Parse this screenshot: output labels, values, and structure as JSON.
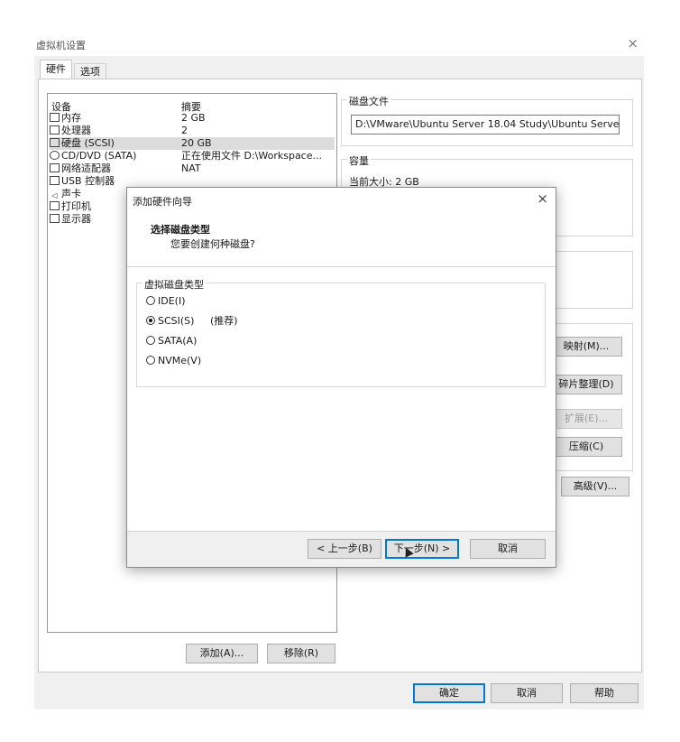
{
  "window": {
    "title": "虚拟机设置",
    "close_glyph": "×"
  },
  "tabs": [
    {
      "label": "硬件"
    },
    {
      "label": "选项"
    }
  ],
  "device_list": {
    "headers": {
      "device": "设备",
      "summary": "摘要"
    },
    "rows": [
      {
        "icon": "memory-icon",
        "name": "内存",
        "summary": "2 GB"
      },
      {
        "icon": "cpu-icon",
        "name": "处理器",
        "summary": "2"
      },
      {
        "icon": "harddisk-icon",
        "name": "硬盘 (SCSI)",
        "summary": "20 GB"
      },
      {
        "icon": "cd-icon",
        "name": "CD/DVD (SATA)",
        "summary": "正在使用文件 D:\\Workspace..."
      },
      {
        "icon": "network-icon",
        "name": "网络适配器",
        "summary": "NAT"
      },
      {
        "icon": "usb-icon",
        "name": "USB 控制器",
        "summary": ""
      },
      {
        "icon": "sound-icon",
        "name": "声卡",
        "summary": ""
      },
      {
        "icon": "printer-icon",
        "name": "打印机",
        "summary": ""
      },
      {
        "icon": "monitor-icon",
        "name": "显示器",
        "summary": ""
      }
    ],
    "add_button": "添加(A)...",
    "remove_button": "移除(R)"
  },
  "right_panel": {
    "disk_file_title": "磁盘文件",
    "disk_file_path": "D:\\VMware\\Ubuntu Server 18.04 Study\\Ubuntu Serve",
    "capacity_title": "容量",
    "current_size": "当前大小: 2 GB",
    "buttons": {
      "map": "映射(M)...",
      "defrag": "碎片整理(D)",
      "expand": "扩展(E)...",
      "compact": "压缩(C)",
      "advanced": "高级(V)..."
    }
  },
  "footer": {
    "ok": "确定",
    "cancel": "取消",
    "help": "帮助"
  },
  "dialog": {
    "title": "添加硬件向导",
    "close_glyph": "×",
    "heading": "选择磁盘类型",
    "subheading": "您要创建何种磁盘?",
    "group_title": "虚拟磁盘类型",
    "options": [
      {
        "label": "IDE(I)",
        "selected": false,
        "note": ""
      },
      {
        "label": "SCSI(S)",
        "selected": true,
        "note": "(推荐)"
      },
      {
        "label": "SATA(A)",
        "selected": false,
        "note": ""
      },
      {
        "label": "NVMe(V)",
        "selected": false,
        "note": ""
      }
    ],
    "buttons": {
      "back": "< 上一步(B)",
      "next": "下一步(N) >",
      "cancel": "取消"
    }
  },
  "colors": {
    "accent": "#0078d7",
    "selected_row": "#dcdcdc",
    "dialog_bg": "#f0f0f0"
  }
}
